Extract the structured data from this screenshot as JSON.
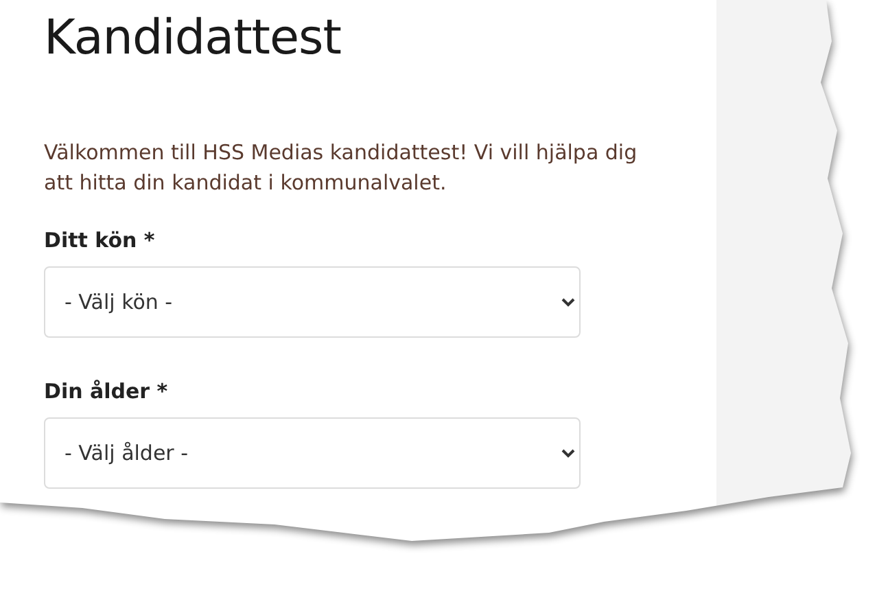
{
  "title": "Kandidattest",
  "intro": "Välkommen till HSS Medias kandidattest! Vi vill hjälpa dig att hitta din kandidat i kommunalvalet.",
  "fields": [
    {
      "label": "Ditt kön *",
      "placeholder": "- Välj kön -"
    },
    {
      "label": "Din ålder *",
      "placeholder": "- Välj ålder -"
    }
  ]
}
